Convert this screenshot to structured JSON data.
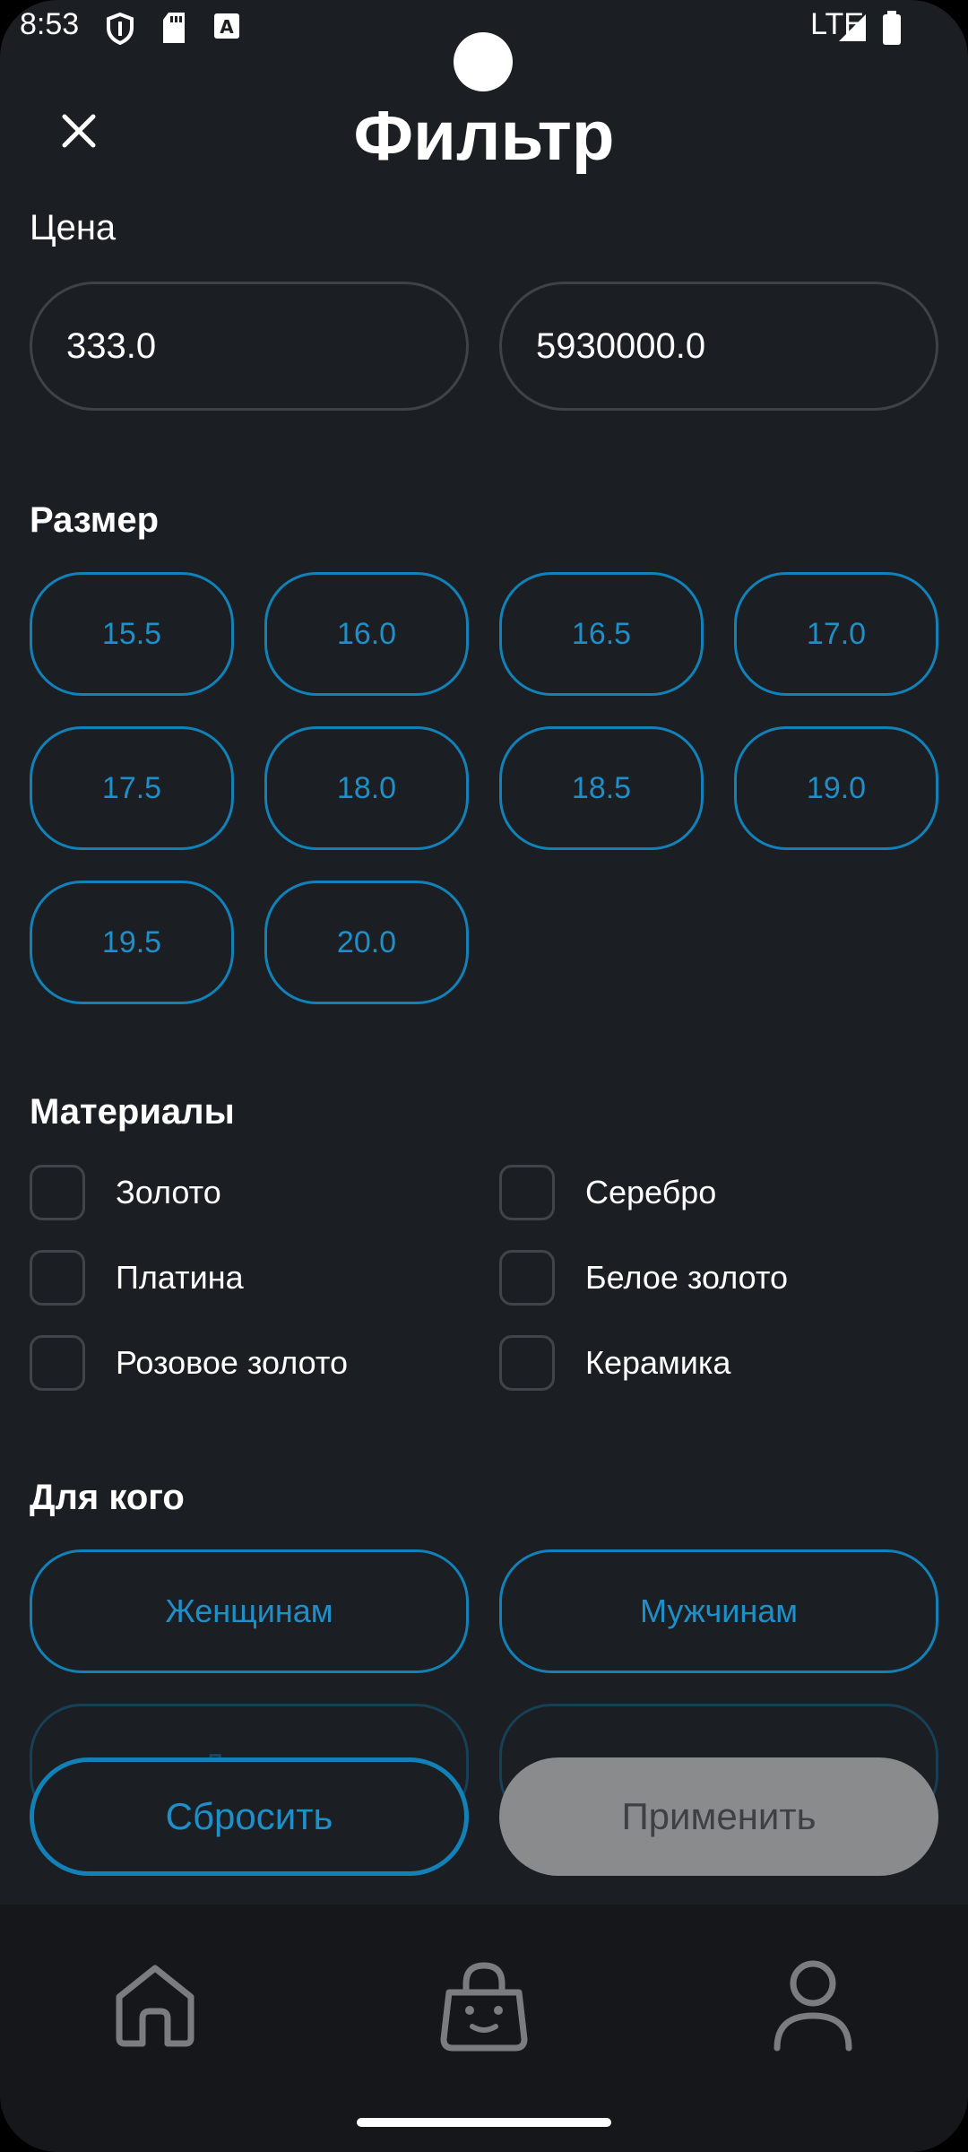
{
  "status": {
    "time": "8:53",
    "network": "LTE"
  },
  "header": {
    "title": "Фильтр"
  },
  "price": {
    "label": "Цена",
    "min": "333.0",
    "max": "5930000.0"
  },
  "size": {
    "label": "Размер",
    "options": [
      "15.5",
      "16.0",
      "16.5",
      "17.0",
      "17.5",
      "18.0",
      "18.5",
      "19.0",
      "19.5",
      "20.0"
    ]
  },
  "materials": {
    "label": "Материалы",
    "items": [
      "Золото",
      "Серебро",
      "Платина",
      "Белое золото",
      "Розовое золото",
      "Керамика"
    ]
  },
  "audience": {
    "label": "Для кого",
    "options": [
      "Женщинам",
      "Мужчинам",
      "Детям"
    ]
  },
  "actions": {
    "reset": "Сбросить",
    "apply": "Применить"
  },
  "nav": {
    "icons": [
      "home-icon",
      "bag-icon",
      "profile-icon"
    ]
  },
  "colors": {
    "background": "#1b1e22",
    "accent": "#1e8fc8",
    "apply_button": "#8a8b8d"
  }
}
